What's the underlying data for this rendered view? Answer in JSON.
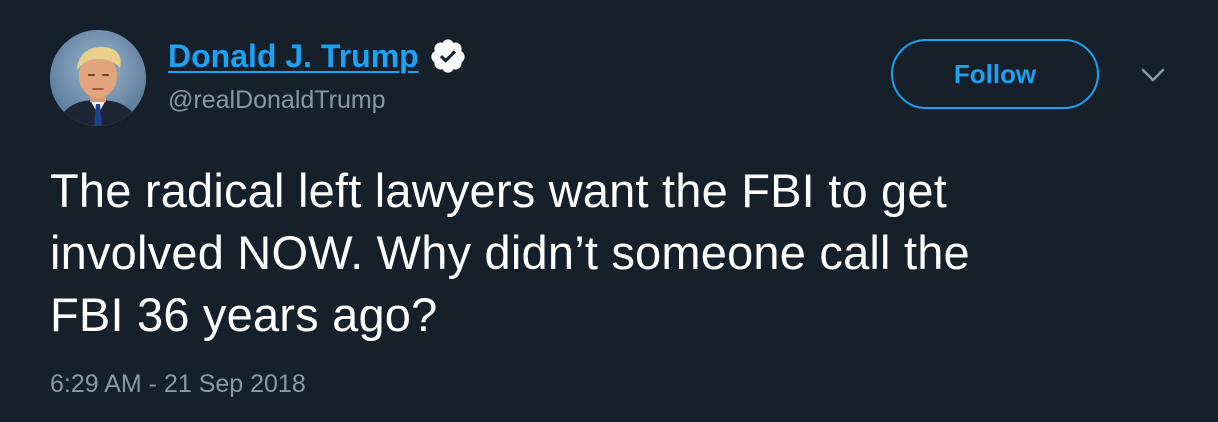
{
  "tweet": {
    "author": {
      "display_name": "Donald J. Trump",
      "handle": "@realDonaldTrump",
      "verified": true,
      "avatar": "profile-photo"
    },
    "follow_label": "Follow",
    "menu_icon": "chevron-down-icon",
    "text_lines": [
      "The radical left lawyers want the FBI to get",
      "involved NOW. Why didn’t someone call the",
      "FBI 36 years ago?"
    ],
    "timestamp": "6:29 AM - 21 Sep 2018"
  },
  "colors": {
    "background": "#15202b",
    "accent": "#1da1f2",
    "text": "#ffffff",
    "secondary_text": "#8899a6"
  }
}
